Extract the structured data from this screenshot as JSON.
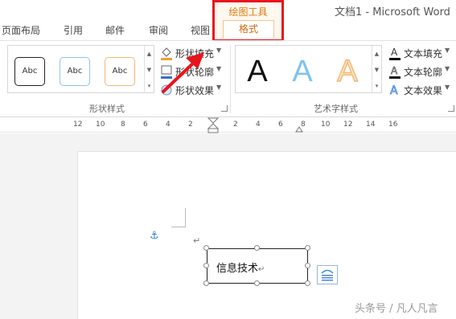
{
  "window": {
    "title": "文档1 - Microsoft Word"
  },
  "tabs": [
    {
      "label": "页面布局"
    },
    {
      "label": "引用"
    },
    {
      "label": "邮件"
    },
    {
      "label": "审阅"
    },
    {
      "label": "视图"
    }
  ],
  "contextual": {
    "group_title": "绘图工具",
    "active_tab": "格式"
  },
  "shape_styles": {
    "group_label": "形状样式",
    "items": [
      {
        "label": "Abc"
      },
      {
        "label": "Abc"
      },
      {
        "label": "Abc"
      }
    ],
    "commands": [
      {
        "label": "形状填充",
        "icon": "paint-bucket-icon"
      },
      {
        "label": "形状轮廓",
        "icon": "pencil-outline-icon"
      },
      {
        "label": "形状效果",
        "icon": "shape-effects-icon"
      }
    ]
  },
  "wordart_styles": {
    "group_label": "艺术字样式",
    "items": [
      {
        "label": "A",
        "color": "#111111"
      },
      {
        "label": "A",
        "color": "#7fc4ea"
      },
      {
        "label": "A",
        "color": "#f6d3a8"
      }
    ],
    "commands": [
      {
        "label": "文本填充",
        "icon": "text-fill-icon"
      },
      {
        "label": "文本轮廓",
        "icon": "text-outline-icon"
      },
      {
        "label": "文本效果",
        "icon": "text-effects-icon"
      }
    ]
  },
  "ruler": {
    "left_numbers": [
      "12",
      "10",
      "8",
      "6",
      "4",
      "2"
    ],
    "right_numbers": [
      "2",
      "4",
      "6",
      "8",
      "10",
      "12",
      "14",
      "16"
    ]
  },
  "document": {
    "paragraph_mark": "↵",
    "anchor_icon": "anchor-icon",
    "textbox": {
      "text": "信息技术",
      "paragraph_mark": "↵"
    },
    "layout_options_icon": "layout-options-icon"
  },
  "annotation": {
    "highlight_color": "#e8141b",
    "arrow_color": "#e8141b"
  },
  "watermark": {
    "text": "头条号 / 凡人凡言"
  }
}
